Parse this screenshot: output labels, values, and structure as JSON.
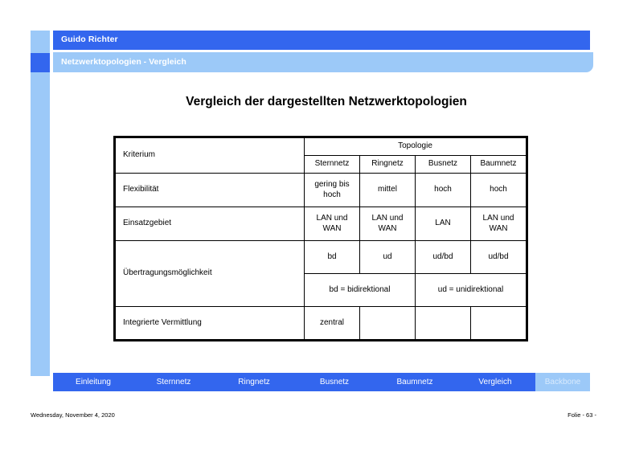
{
  "header": {
    "author": "Guido Richter",
    "topic": "Netzwerktopologien  - Vergleich"
  },
  "slide": {
    "title": "Vergleich der dargestellten Netzwerktopologien"
  },
  "table": {
    "criterion_header": "Kriterium",
    "group_header": "Topologie",
    "columns": [
      "Sternnetz",
      "Ringnetz",
      "Busnetz",
      "Baumnetz"
    ],
    "rows": [
      {
        "criterion": "Flexibilität",
        "values": [
          "gering bis hoch",
          "mittel",
          "hoch",
          "hoch"
        ]
      },
      {
        "criterion": "Einsatzgebiet",
        "values": [
          "LAN und WAN",
          "LAN und WAN",
          "LAN",
          "LAN und WAN"
        ]
      },
      {
        "criterion": "Übertragungsmöglichkeit",
        "values": [
          "bd",
          "ud",
          "ud/bd",
          "ud/bd"
        ],
        "legend": [
          "bd = bidirektional",
          "ud = unidirektional"
        ]
      },
      {
        "criterion": "Integrierte Vermittlung",
        "values": [
          "zentral",
          "",
          "",
          ""
        ]
      }
    ]
  },
  "nav": {
    "items": [
      {
        "label": "Einleitung",
        "current": false
      },
      {
        "label": "Sternnetz",
        "current": false
      },
      {
        "label": "Ringnetz",
        "current": false
      },
      {
        "label": "Busnetz",
        "current": false
      },
      {
        "label": "Baumnetz",
        "current": false
      },
      {
        "label": "Vergleich",
        "current": false
      },
      {
        "label": "Backbone",
        "current": true
      }
    ]
  },
  "footer": {
    "date": "Wednesday, November 4, 2020",
    "page": "Folie - 63 -"
  },
  "colors": {
    "accent_dark": "#3366EE",
    "accent_light": "#9CC9F8",
    "text": "#000000",
    "on_accent": "#FFFFFF"
  }
}
